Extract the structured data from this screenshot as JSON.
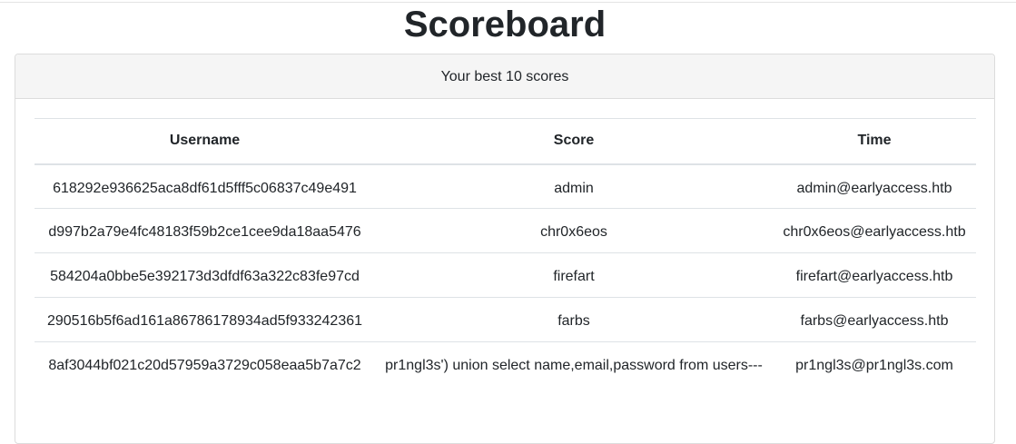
{
  "page": {
    "title": "Scoreboard"
  },
  "card": {
    "header": "Your best 10 scores"
  },
  "table": {
    "columns": [
      "Username",
      "Score",
      "Time"
    ],
    "rows": [
      [
        "618292e936625aca8df61d5fff5c06837c49e491",
        "admin",
        "admin@earlyaccess.htb"
      ],
      [
        "d997b2a79e4fc48183f59b2ce1cee9da18aa5476",
        "chr0x6eos",
        "chr0x6eos@earlyaccess.htb"
      ],
      [
        "584204a0bbe5e392173d3dfdf63a322c83fe97cd",
        "firefart",
        "firefart@earlyaccess.htb"
      ],
      [
        "290516b5f6ad161a86786178934ad5f933242361",
        "farbs",
        "farbs@earlyaccess.htb"
      ],
      [
        "8af3044bf021c20d57959a3729c058eaa5b7a7c2",
        "pr1ngl3s') union select name,email,password from users---",
        "pr1ngl3s@pr1ngl3s.com"
      ]
    ]
  }
}
